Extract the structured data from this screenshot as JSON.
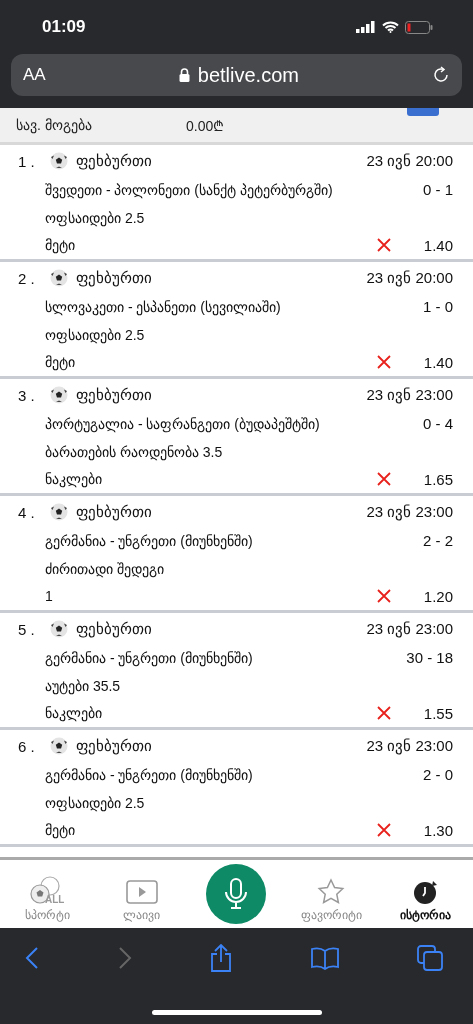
{
  "status_bar": {
    "time": "01:09"
  },
  "browser": {
    "text_size": "AA",
    "url": "betlive.com"
  },
  "summary": {
    "label": "სავ. მოგება",
    "value": "0.00₾"
  },
  "bets": [
    {
      "number": "1 .",
      "sport": "ფეხბურთი",
      "date": "23 ივნ 20:00",
      "match": "შვედეთი - პოლონეთი (სანქტ პეტერბურგში)",
      "score": "0 - 1",
      "market": "ოფსაიდები 2.5",
      "pick": "მეტი",
      "lost": true,
      "odds": "1.40"
    },
    {
      "number": "2 .",
      "sport": "ფეხბურთი",
      "date": "23 ივნ 20:00",
      "match": "სლოვაკეთი - ესპანეთი (სევილიაში)",
      "score": "1 - 0",
      "market": "ოფსაიდები 2.5",
      "pick": "მეტი",
      "lost": true,
      "odds": "1.40"
    },
    {
      "number": "3 .",
      "sport": "ფეხბურთი",
      "date": "23 ივნ 23:00",
      "match": "პორტუგალია - საფრანგეთი (ბუდაპეშტში)",
      "score": "0 - 4",
      "market": "ბარათების რაოდენობა 3.5",
      "pick": "ნაკლები",
      "lost": true,
      "odds": "1.65"
    },
    {
      "number": "4 .",
      "sport": "ფეხბურთი",
      "date": "23 ივნ 23:00",
      "match": "გერმანია - უნგრეთი (მიუნხენში)",
      "score": "2 - 2",
      "market": "ძირითადი შედეგი",
      "pick": "1",
      "lost": true,
      "odds": "1.20"
    },
    {
      "number": "5 .",
      "sport": "ფეხბურთი",
      "date": "23 ივნ 23:00",
      "match": "გერმანია - უნგრეთი (მიუნხენში)",
      "score": "30 - 18",
      "market": "აუტები 35.5",
      "pick": "ნაკლები",
      "lost": true,
      "odds": "1.55"
    },
    {
      "number": "6 .",
      "sport": "ფეხბურთი",
      "date": "23 ივნ 23:00",
      "match": "გერმანია - უნგრეთი (მიუნხენში)",
      "score": "2 - 0",
      "market": "ოფსაიდები 2.5",
      "pick": "მეტი",
      "lost": true,
      "odds": "1.30"
    }
  ],
  "nav": [
    {
      "kind": "sports",
      "label": "სპორტი",
      "icon_label": "ALL",
      "selected": false
    },
    {
      "kind": "live",
      "label": "ლაივი",
      "selected": false
    },
    {
      "kind": "mic"
    },
    {
      "kind": "favorites",
      "label": "ფავორიტი",
      "selected": false
    },
    {
      "kind": "history",
      "label": "ისტორია",
      "selected": true
    }
  ]
}
